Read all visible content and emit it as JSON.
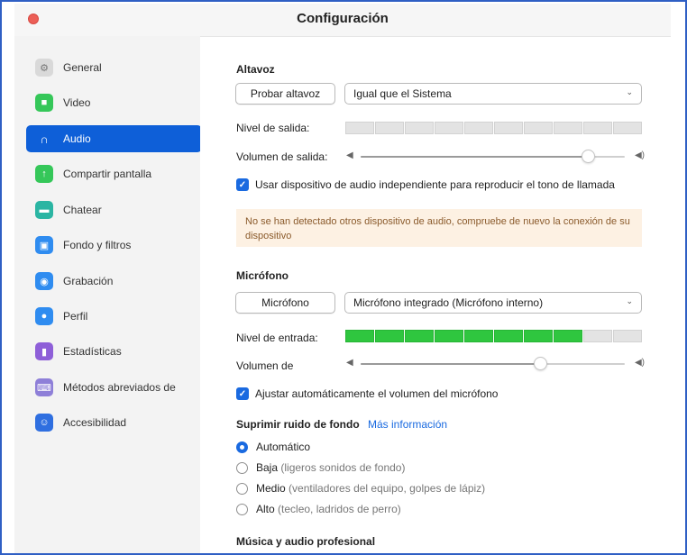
{
  "window": {
    "title": "Configuración"
  },
  "sidebar": {
    "items": [
      {
        "label": "General",
        "icon": "gear-icon",
        "color": "#d9d9d9"
      },
      {
        "label": "Video",
        "icon": "video-icon",
        "color": "#35c759"
      },
      {
        "label": "Audio",
        "icon": "headphones-icon",
        "color": "#0e5fd8",
        "active": true
      },
      {
        "label": "Compartir pantalla",
        "icon": "share-screen-icon",
        "color": "#35c759"
      },
      {
        "label": "Chatear",
        "icon": "chat-icon",
        "color": "#2bb5a3"
      },
      {
        "label": "Fondo y filtros",
        "icon": "background-icon",
        "color": "#2f8cf0"
      },
      {
        "label": "Grabación",
        "icon": "record-icon",
        "color": "#2f8cf0"
      },
      {
        "label": "Perfil",
        "icon": "profile-icon",
        "color": "#2f8cf0"
      },
      {
        "label": "Estadísticas",
        "icon": "statistics-icon",
        "color": "#8e5fd8"
      },
      {
        "label": "Métodos abreviados de",
        "icon": "keyboard-icon",
        "color": "#8e7fd8"
      },
      {
        "label": "Accesibilidad",
        "icon": "accessibility-icon",
        "color": "#2f6fe0"
      }
    ]
  },
  "speaker": {
    "heading": "Altavoz",
    "test_button": "Probar altavoz",
    "device": "Igual que el Sistema",
    "output_level_label": "Nivel de salida:",
    "output_level_fraction": 0.0,
    "output_volume_label": "Volumen de salida:",
    "output_volume_fraction": 0.86,
    "separate_device_label": "Usar dispositivo de audio independiente para reproducir el tono de llamada",
    "separate_device_checked": true,
    "warning": "No se han detectado otros dispositivo de audio, compruebe de nuevo la conexión de su dispositivo"
  },
  "microphone": {
    "heading": "Micrófono",
    "test_button": "Micrófono",
    "device": "Micrófono integrado (Micrófono interno)",
    "input_level_label": "Nivel de entrada:",
    "input_level_fraction": 0.8,
    "input_volume_label": "Volumen de",
    "input_volume_fraction": 0.68,
    "auto_adjust_label": "Ajustar automáticamente el volumen del micrófono",
    "auto_adjust_checked": true
  },
  "noise": {
    "heading": "Suprimir ruido de fondo",
    "more_info": "Más información",
    "options": [
      {
        "label": "Automático",
        "hint": "",
        "selected": true
      },
      {
        "label": "Baja",
        "hint": "(ligeros sonidos de fondo)",
        "selected": false
      },
      {
        "label": "Medio",
        "hint": "(ventiladores del equipo, golpes de lápiz)",
        "selected": false
      },
      {
        "label": "Alto",
        "hint": "(tecleo, ladridos de perro)",
        "selected": false
      }
    ]
  },
  "music": {
    "heading": "Música y audio profesional"
  }
}
